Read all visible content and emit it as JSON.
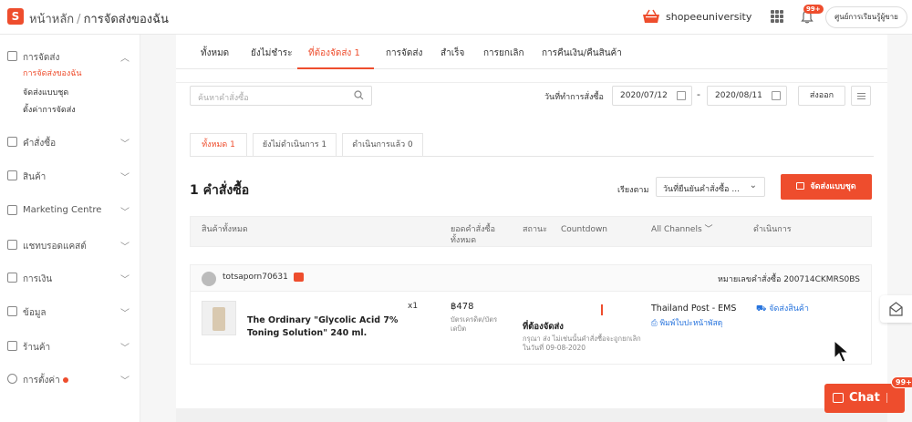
{
  "header": {
    "logo_letter": "S",
    "home": "หน้าหลัก",
    "separator": "/",
    "page": "การจัดส่งของฉัน",
    "shop_name": "shopeeuniversity",
    "bell_badge": "99+",
    "learn_button": "ศูนย์การเรียนรู้ผู้ขาย"
  },
  "sidebar": {
    "sections": [
      {
        "label": "การจัดส่ง",
        "icon": "truck-icon",
        "chevron": "︿"
      },
      {
        "label": "คำสั่งซื้อ",
        "icon": "clipboard-icon",
        "chevron": "﹀"
      },
      {
        "label": "สินค้า",
        "icon": "bag-icon",
        "chevron": "﹀"
      },
      {
        "label": "Marketing Centre",
        "icon": "tag-icon",
        "chevron": "﹀"
      },
      {
        "label": "แชทบรอดแคสต์",
        "icon": "broadcast-icon",
        "chevron": "﹀"
      },
      {
        "label": "การเงิน",
        "icon": "wallet-icon",
        "chevron": "﹀"
      },
      {
        "label": "ข้อมูล",
        "icon": "chart-icon",
        "chevron": "﹀"
      },
      {
        "label": "ร้านค้า",
        "icon": "store-icon",
        "chevron": "﹀"
      },
      {
        "label": "การตั้งค่า",
        "icon": "gear-icon",
        "chevron": "﹀"
      }
    ],
    "shipping_items": [
      "การจัดส่งของฉัน",
      "จัดส่งแบบชุด",
      "ตั้งค่าการจัดส่ง"
    ]
  },
  "tabs": [
    "ทั้งหมด",
    "ยังไม่ชำระ",
    "ที่ต้องจัดส่ง  1",
    "การจัดส่ง",
    "สำเร็จ",
    "การยกเลิก",
    "การคืนเงิน/คืนสินค้า"
  ],
  "filters": {
    "search_placeholder": "ค้นหาคำสั่งซื้อ",
    "date_label": "วันที่ทำการสั่งซื้อ",
    "date_from": "2020/07/12",
    "date_sep": "-",
    "date_to": "2020/08/11",
    "export": "ส่งออก"
  },
  "subtabs": [
    "ทั้งหมด 1",
    "ยังไม่ดำเนินการ 1",
    "ดำเนินการแล้ว 0"
  ],
  "summary": {
    "count": "1 คำสั่งซื้อ",
    "sort_label": "เรียงตาม",
    "sort_value": "วันที่ยืนยันคำสั่งซื้อ ...",
    "sort_chevron": "⌄",
    "batch_ship": "จัดส่งแบบชุด"
  },
  "table": {
    "headers": {
      "product": "สินค้าทั้งหมด",
      "total_line1": "ยอดคำสั่งซื้อ",
      "total_line2": "ทั้งหมด",
      "status": "สถานะ",
      "countdown": "Countdown",
      "channels": "All Channels",
      "channels_chevron": "﹀",
      "action": "ดำเนินการ"
    }
  },
  "order": {
    "username": "totsaporn70631",
    "order_no": "หมายเลขคำสั่งซื้อ 200714CKMRS0BS",
    "product_name": "The Ordinary \"Glycolic Acid 7% Toning Solution\" 240 ml.",
    "qty": "x1",
    "price": "฿478",
    "payment": "บัตรเครดิต/บัตรเดบิต",
    "status": "ที่ต้องจัดส่ง",
    "status_note": "กรุณา ส่ง ไม่เช่นนั้นคำสั่งซื้อจะถูกยกเลิกในวันที่ 09-08-2020",
    "carrier": "Thailand Post - EMS",
    "print_label": "พิมพ์ใบปะหน้าพัสดุ",
    "arrange": "จัดส่งสินค้า"
  },
  "chat": {
    "label": "Chat",
    "badge": "99+"
  },
  "colors": {
    "brand": "#ee4d2d",
    "link": "#2673dd"
  }
}
